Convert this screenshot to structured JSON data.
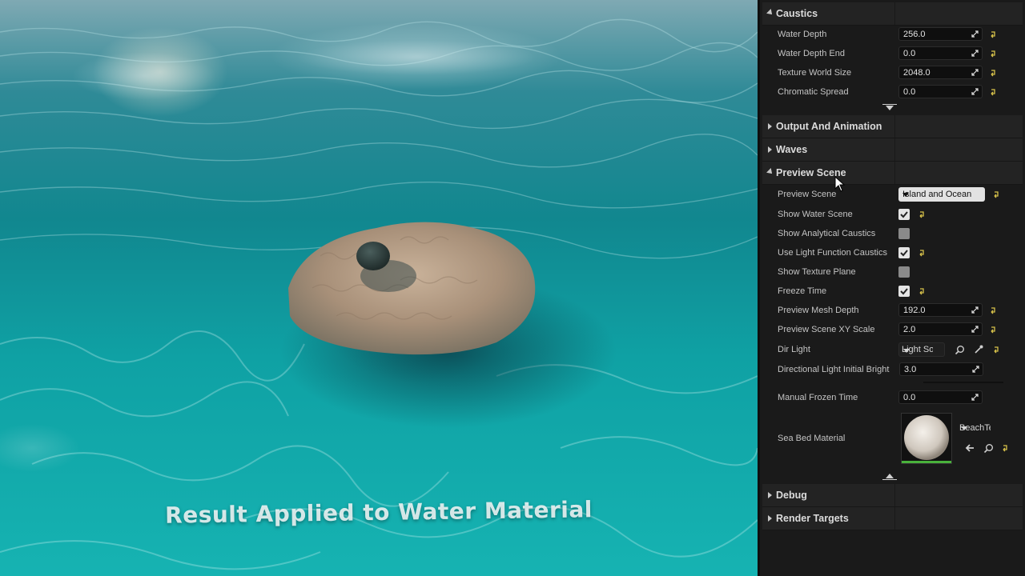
{
  "viewport": {
    "caption": "Result Applied to Water Material"
  },
  "colors": {
    "panel_bg": "#1a1a1a",
    "category_bg": "#232323",
    "reset_arrow": "#d8c24a",
    "thumbnail_bar": "#49b13b"
  },
  "details": {
    "caustics": {
      "title": "Caustics",
      "water_depth": {
        "label": "Water Depth",
        "value": "256.0"
      },
      "water_depth_end": {
        "label": "Water Depth End",
        "value": "0.0"
      },
      "texture_world_size": {
        "label": "Texture World Size",
        "value": "2048.0"
      },
      "chromatic_spread": {
        "label": "Chromatic Spread",
        "value": "0.0"
      }
    },
    "output_and_animation": {
      "title": "Output And Animation"
    },
    "waves": {
      "title": "Waves"
    },
    "preview_scene": {
      "title": "Preview Scene",
      "preview_scene": {
        "label": "Preview Scene",
        "value": "Island and Ocean"
      },
      "show_water_scene": {
        "label": "Show Water Scene",
        "checked": true
      },
      "show_analytical_caustics": {
        "label": "Show Analytical Caustics",
        "checked": false
      },
      "use_light_function_caustics": {
        "label": "Use Light Function Caustics",
        "checked": true
      },
      "show_texture_plane": {
        "label": "Show Texture Plane",
        "checked": false
      },
      "freeze_time": {
        "label": "Freeze Time",
        "checked": true
      },
      "preview_mesh_depth": {
        "label": "Preview Mesh Depth",
        "value": "192.0"
      },
      "preview_scene_xy_scale": {
        "label": "Preview Scene XY Scale",
        "value": "2.0"
      },
      "dir_light": {
        "label": "Dir Light",
        "value": "Light Sou"
      },
      "directional_light_initial_bright": {
        "label": "Directional Light Initial Bright",
        "value": "3.0"
      },
      "manual_frozen_time": {
        "label": "Manual Frozen Time",
        "value": "0.0"
      },
      "sea_bed_material": {
        "label": "Sea Bed Material",
        "value": "BeachTe"
      }
    },
    "debug": {
      "title": "Debug"
    },
    "render_targets": {
      "title": "Render Targets"
    }
  }
}
